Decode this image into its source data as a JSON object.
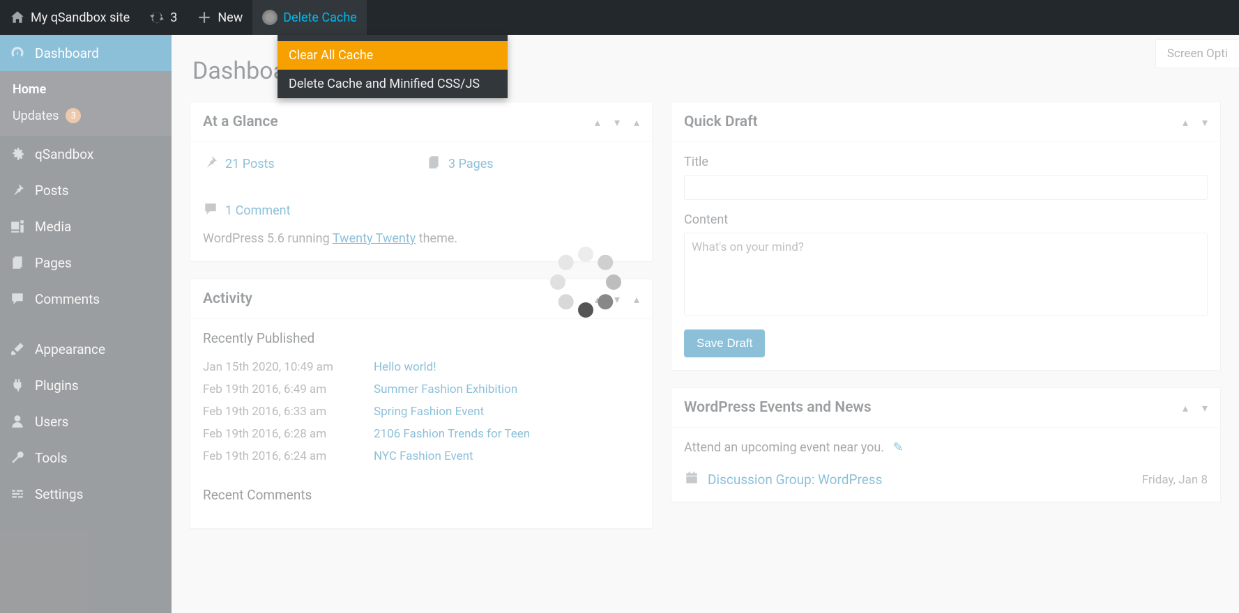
{
  "adminbar": {
    "site_name": "My qSandbox site",
    "updates_count": "3",
    "new_label": "New",
    "delete_cache_label": "Delete Cache"
  },
  "dropdown": {
    "items": [
      {
        "label": "Clear All Cache",
        "highlight": true
      },
      {
        "label": "Delete Cache and Minified CSS/JS",
        "highlight": false
      }
    ]
  },
  "screen_options": "Screen Opti",
  "sidebar": {
    "dashboard": "Dashboard",
    "home": "Home",
    "updates": "Updates",
    "updates_count": "3",
    "items": [
      "qSandbox",
      "Posts",
      "Media",
      "Pages",
      "Comments",
      "Appearance",
      "Plugins",
      "Users",
      "Tools",
      "Settings"
    ]
  },
  "page_title": "Dashboard",
  "at_a_glance": {
    "title": "At a Glance",
    "posts": "21 Posts",
    "pages": "3 Pages",
    "comments": "1 Comment",
    "running_pre": "WordPress 5.6 running ",
    "theme": "Twenty Twenty",
    "running_post": " theme."
  },
  "activity": {
    "title": "Activity",
    "recently_published": "Recently Published",
    "items": [
      {
        "date": "Jan 15th 2020, 10:49 am",
        "title": "Hello world!"
      },
      {
        "date": "Feb 19th 2016, 6:49 am",
        "title": "Summer Fashion Exhibition"
      },
      {
        "date": "Feb 19th 2016, 6:33 am",
        "title": "Spring Fashion Event"
      },
      {
        "date": "Feb 19th 2016, 6:28 am",
        "title": "2106 Fashion Trends for Teen"
      },
      {
        "date": "Feb 19th 2016, 6:24 am",
        "title": "NYC Fashion Event"
      }
    ],
    "recent_comments": "Recent Comments"
  },
  "quick_draft": {
    "heading": "Quick Draft",
    "title_label": "Title",
    "content_label": "Content",
    "content_placeholder": "What's on your mind?",
    "save_label": "Save Draft"
  },
  "events": {
    "heading": "WordPress Events and News",
    "attend": "Attend an upcoming event near you.",
    "item_title": "Discussion Group: WordPress",
    "item_date": "Friday, Jan 8"
  }
}
